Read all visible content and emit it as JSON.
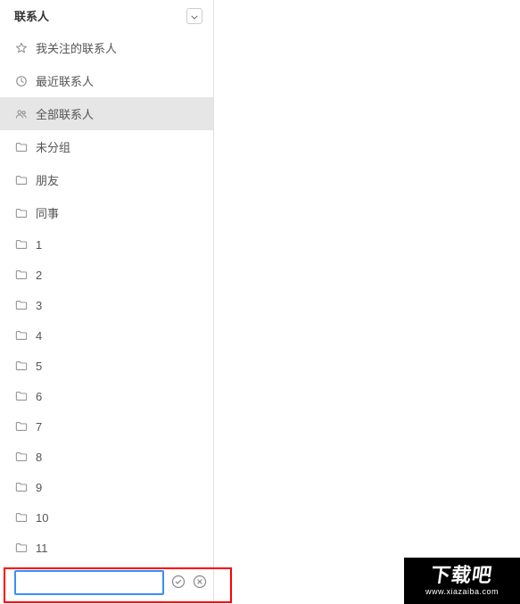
{
  "sidebar": {
    "title": "联系人",
    "items": [
      {
        "icon": "star",
        "label": "我关注的联系人",
        "selected": false
      },
      {
        "icon": "clock",
        "label": "最近联系人",
        "selected": false
      },
      {
        "icon": "people",
        "label": "全部联系人",
        "selected": true
      },
      {
        "icon": "folder",
        "label": "未分组",
        "selected": false
      },
      {
        "icon": "folder",
        "label": "朋友",
        "selected": false
      },
      {
        "icon": "folder",
        "label": "同事",
        "selected": false
      },
      {
        "icon": "folder",
        "label": "1",
        "selected": false
      },
      {
        "icon": "folder",
        "label": "2",
        "selected": false
      },
      {
        "icon": "folder",
        "label": "3",
        "selected": false
      },
      {
        "icon": "folder",
        "label": "4",
        "selected": false
      },
      {
        "icon": "folder",
        "label": "5",
        "selected": false
      },
      {
        "icon": "folder",
        "label": "6",
        "selected": false
      },
      {
        "icon": "folder",
        "label": "7",
        "selected": false
      },
      {
        "icon": "folder",
        "label": "8",
        "selected": false
      },
      {
        "icon": "folder",
        "label": "9",
        "selected": false
      },
      {
        "icon": "folder",
        "label": "10",
        "selected": false
      },
      {
        "icon": "folder",
        "label": "11",
        "selected": false
      }
    ],
    "new_folder_input_value": ""
  },
  "watermark": {
    "big_text": "下载吧",
    "url": "www.xiazaiba.com"
  }
}
